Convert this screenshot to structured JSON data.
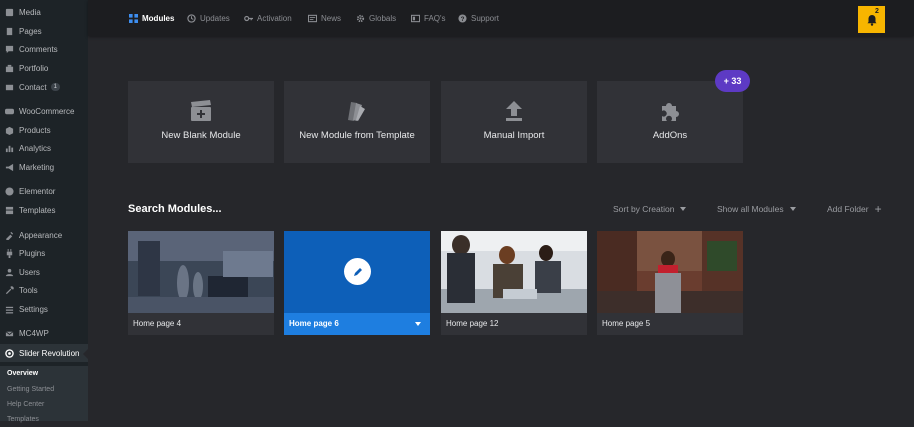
{
  "sidebar": {
    "items": [
      {
        "label": "Media",
        "icon": "media-icon"
      },
      {
        "label": "Pages",
        "icon": "pages-icon"
      },
      {
        "label": "Comments",
        "icon": "comments-icon"
      },
      {
        "label": "Portfolio",
        "icon": "portfolio-icon"
      },
      {
        "label": "Contact",
        "icon": "contact-icon",
        "badge": "1"
      },
      {
        "label": "WooCommerce",
        "icon": "woocommerce-icon"
      },
      {
        "label": "Products",
        "icon": "products-icon"
      },
      {
        "label": "Analytics",
        "icon": "analytics-icon"
      },
      {
        "label": "Marketing",
        "icon": "marketing-icon"
      },
      {
        "label": "Elementor",
        "icon": "elementor-icon"
      },
      {
        "label": "Templates",
        "icon": "templates-icon"
      },
      {
        "label": "Appearance",
        "icon": "appearance-icon"
      },
      {
        "label": "Plugins",
        "icon": "plugins-icon"
      },
      {
        "label": "Users",
        "icon": "users-icon"
      },
      {
        "label": "Tools",
        "icon": "tools-icon"
      },
      {
        "label": "Settings",
        "icon": "settings-icon"
      },
      {
        "label": "MC4WP",
        "icon": "mc4wp-icon"
      },
      {
        "label": "Slider Revolution",
        "icon": "slider-revolution-icon"
      }
    ],
    "submenu": [
      "Overview",
      "Getting Started",
      "Help Center",
      "Templates"
    ]
  },
  "topnav": {
    "items": [
      {
        "label": "Modules",
        "icon": "grid-icon"
      },
      {
        "label": "Updates",
        "icon": "updates-icon"
      },
      {
        "label": "Activation",
        "icon": "key-icon"
      },
      {
        "label": "News",
        "icon": "news-icon"
      },
      {
        "label": "Globals",
        "icon": "gear-icon"
      },
      {
        "label": "FAQ's",
        "icon": "faq-icon"
      },
      {
        "label": "Support",
        "icon": "support-icon"
      }
    ],
    "notifications": "2"
  },
  "actions": {
    "cards": [
      {
        "label": "New Blank Module",
        "icon": "clapperboard-plus-icon"
      },
      {
        "label": "New Module from Template",
        "icon": "template-swatch-icon"
      },
      {
        "label": "Manual Import",
        "icon": "upload-icon"
      },
      {
        "label": "AddOns",
        "icon": "puzzle-icon"
      }
    ],
    "addons_badge": "+ 33"
  },
  "modules": {
    "search_label": "Search Modules...",
    "sort_label": "Sort by Creation",
    "filter_label": "Show all Modules",
    "add_folder_label": "Add Folder",
    "items": [
      {
        "label": "Home page 4"
      },
      {
        "label": "Home page 6"
      },
      {
        "label": "Home page 12"
      },
      {
        "label": "Home page 5"
      }
    ]
  },
  "colors": {
    "accent": "#1e7ee0",
    "badge": "#5d3ac4",
    "notification": "#f7b500"
  }
}
